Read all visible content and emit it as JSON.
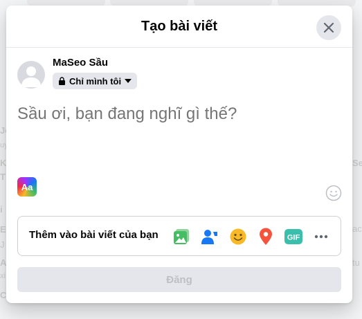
{
  "modal": {
    "title": "Tạo bài viết",
    "close_icon": "close-icon"
  },
  "user": {
    "name": "MaSeo Sầu",
    "privacy_label": "Chỉ mình tôi",
    "privacy_icon": "lock-icon"
  },
  "composer": {
    "placeholder": "Sầu ơi, bạn đang nghĩ gì thế?"
  },
  "text_format": {
    "label": "Aa"
  },
  "add_to_post": {
    "label": "Thêm vào bài viết của bạn",
    "icons": [
      "photo-video-icon",
      "tag-people-icon",
      "feeling-icon",
      "check-in-icon",
      "gif-icon",
      "more-icon"
    ],
    "gif_label": "GIF"
  },
  "post_button": {
    "label": "Đăng"
  },
  "colors": {
    "photo": "#45bd62",
    "tag": "#1877f2",
    "feeling": "#f7b928",
    "checkin": "#f5533d",
    "gif": "#3bbfad",
    "disabled_button": "#e4e6eb"
  },
  "background": {
    "left_fragments": [
      "Jo",
      "uy",
      "K",
      "T",
      "i",
      "E",
      "J",
      "A",
      "xi",
      "C"
    ],
    "right_fragments": [
      "Se",
      "ac",
      "tu"
    ]
  }
}
